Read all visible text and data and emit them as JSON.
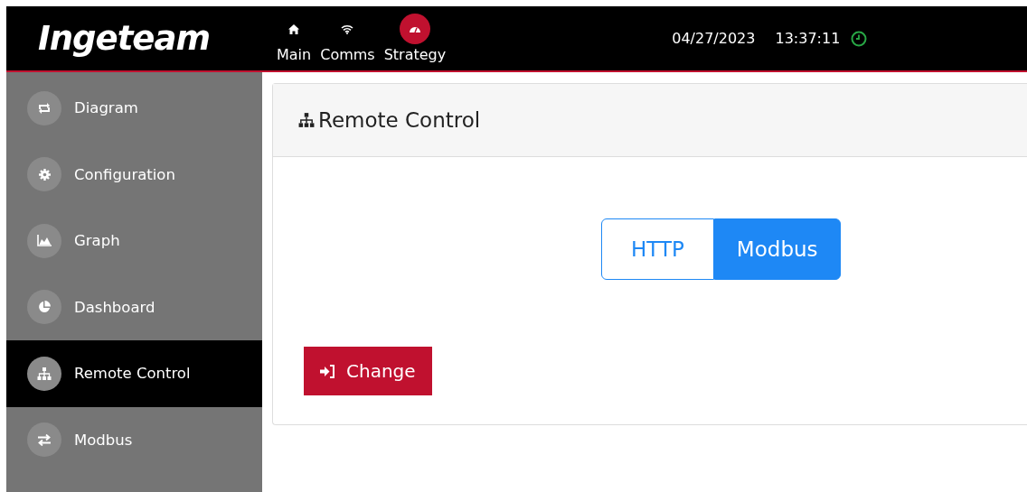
{
  "header": {
    "logo": "Ingeteam",
    "nav": [
      {
        "label": "Main",
        "selected": false
      },
      {
        "label": "Comms",
        "selected": false
      },
      {
        "label": "Strategy",
        "selected": true
      }
    ],
    "date": "04/27/2023",
    "time": "13:37:11"
  },
  "sidebar": {
    "items": [
      {
        "label": "Diagram",
        "selected": false
      },
      {
        "label": "Configuration",
        "selected": false
      },
      {
        "label": "Graph",
        "selected": false
      },
      {
        "label": "Dashboard",
        "selected": false
      },
      {
        "label": "Remote Control",
        "selected": true
      },
      {
        "label": "Modbus",
        "selected": false
      }
    ]
  },
  "panel": {
    "title": "Remote Control",
    "options": [
      {
        "label": "HTTP",
        "selected": false
      },
      {
        "label": "Modbus",
        "selected": true
      }
    ],
    "button": "Change"
  }
}
